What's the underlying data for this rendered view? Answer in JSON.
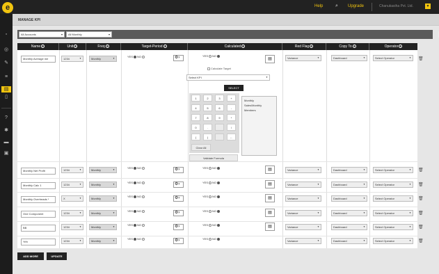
{
  "topbar": {
    "help": "Help",
    "upgrade": "Upgrade",
    "company": "Chanukasiha Pvt. Ltd.",
    "logo": "e"
  },
  "page": {
    "title": "MANAGE KPI"
  },
  "filters": {
    "department": "All Accounts",
    "frequency": "All Monthly"
  },
  "table": {
    "headers": [
      "Name",
      "Unit",
      "Freq",
      "Target-Period",
      "Calculated",
      "Red Flag",
      "Copy To",
      "Operator"
    ],
    "rows": [
      {
        "name": "Monthly Average me",
        "unit": "1234",
        "freq": "Monthly",
        "red_flag": "Variance",
        "copy_to": "Dashboard",
        "operator": "Select Operator"
      },
      {
        "name": "Monthly Net Profit",
        "unit": "1234",
        "freq": "Monthly",
        "red_flag": "Variance",
        "copy_to": "Dashboard",
        "operator": "Select Operator"
      },
      {
        "name": "Monthly Calc 1",
        "unit": "1234",
        "freq": "Monthly",
        "red_flag": "Variance",
        "copy_to": "Dashboard",
        "operator": "Select Operator"
      },
      {
        "name": "Monthly Overheads *",
        "unit": "X",
        "freq": "Monthly",
        "red_flag": "Variance",
        "copy_to": "Dashboard",
        "operator": "Select Operator"
      },
      {
        "name": "One Component",
        "unit": "1234",
        "freq": "Monthly",
        "red_flag": "Variance",
        "copy_to": "Dashboard",
        "operator": "Select Operator"
      },
      {
        "name": "BB",
        "unit": "1234",
        "freq": "Monthly",
        "red_flag": "Variance",
        "copy_to": "Dashboard",
        "operator": "Select Operator"
      },
      {
        "name": "%%",
        "unit": "1234",
        "freq": "Monthly",
        "red_flag": "Variance",
        "copy_to": "Dashboard",
        "operator": "Select Operator"
      }
    ]
  },
  "radio": {
    "yes": "YES",
    "no": "NO"
  },
  "calc_panel": {
    "checkbox_label": "Calculate Target",
    "select_kpi": "Select KPI",
    "select_button": "SELECT",
    "keys": [
      "1",
      "2",
      "3",
      "+",
      "4",
      "5",
      "6",
      "-",
      "7",
      "8",
      "9",
      "*",
      "0",
      ".",
      "",
      "/",
      "(",
      ")",
      "",
      "←"
    ],
    "clear_all": "Clear All",
    "validate": "Validate Formula",
    "kpi_list": [
      "Monthly",
      "Sales/Monthly",
      "Members"
    ]
  },
  "buttons": {
    "add_more": "ADD MORE",
    "update": "UPDATE"
  },
  "colors": {
    "accent": "#f1c40f",
    "dark": "#222222"
  }
}
